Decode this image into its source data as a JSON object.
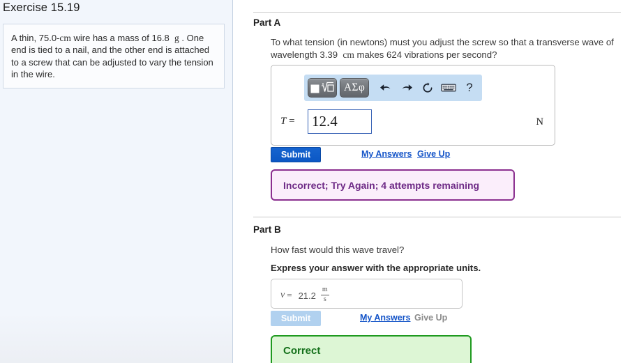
{
  "exercise": {
    "title": "Exercise 15.19",
    "problem_statement": "A thin, 75.0-cm wire has a mass of 16.8  g . One end is tied to a nail, and the other end is attached to a screw that can be adjusted to vary the tension in the wire."
  },
  "part_a": {
    "label": "Part A",
    "question": "To what tension (in newtons) must you adjust the screw so that a transverse wave of wavelength 3.39  cm makes 624 vibrations per second?",
    "toolbar": {
      "template_button": "template-icon",
      "greek_button": "ΑΣφ",
      "undo_icon": "undo-icon",
      "redo_icon": "redo-icon",
      "reset_icon": "reset-icon",
      "keyboard_icon": "keyboard-icon",
      "help_icon": "?"
    },
    "variable": "T",
    "equals": "=",
    "value": "12.4",
    "unit": "N",
    "submit_label": "Submit",
    "my_answers_label": "My Answers",
    "give_up_label": "Give Up",
    "feedback": "Incorrect; Try Again; 4 attempts remaining"
  },
  "part_b": {
    "label": "Part B",
    "question": "How fast would this wave travel?",
    "instruction": "Express your answer with the appropriate units.",
    "variable": "v",
    "equals": "=",
    "value": "21.2",
    "unit_numerator": "m",
    "unit_denominator": "s",
    "submit_label": "Submit",
    "my_answers_label": "My Answers",
    "give_up_label": "Give Up",
    "feedback": "Correct"
  },
  "colors": {
    "accent_blue": "#0b57c4",
    "link_blue": "#1454c8",
    "toolbar_blue": "#c5ddf3",
    "incorrect_border": "#8b2f8f",
    "incorrect_bg": "#fbeefb",
    "incorrect_text": "#6e2a86",
    "correct_border": "#1f9a1f",
    "correct_bg": "#ddf6d5",
    "correct_text": "#14701a",
    "left_panel_bg": "#f2f6fc"
  }
}
